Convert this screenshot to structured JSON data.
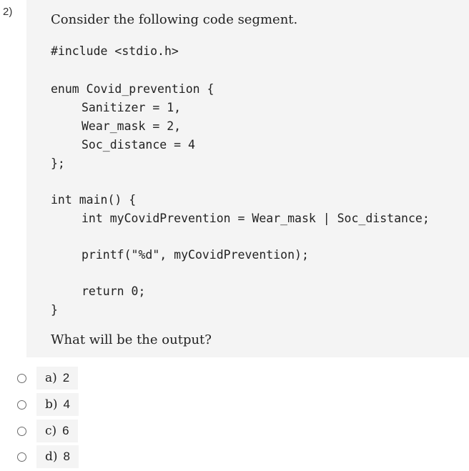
{
  "question": {
    "number": "2)",
    "intro": "Consider the following code segment.",
    "code_lines": [
      "#include <stdio.h>",
      "enum Covid_prevention {",
      "Sanitizer = 1,",
      "Wear_mask = 2,",
      "Soc_distance = 4",
      "};",
      "int main() {",
      "int myCovidPrevention = Wear_mask | Soc_distance;",
      "printf(\"%d\", myCovidPrevention);",
      "return 0;",
      "}"
    ],
    "prompt": "What will be the output?"
  },
  "options": [
    {
      "letter": "a)",
      "value": "2"
    },
    {
      "letter": "b)",
      "value": "4"
    },
    {
      "letter": "c)",
      "value": "6"
    },
    {
      "letter": "d)",
      "value": "8"
    }
  ]
}
